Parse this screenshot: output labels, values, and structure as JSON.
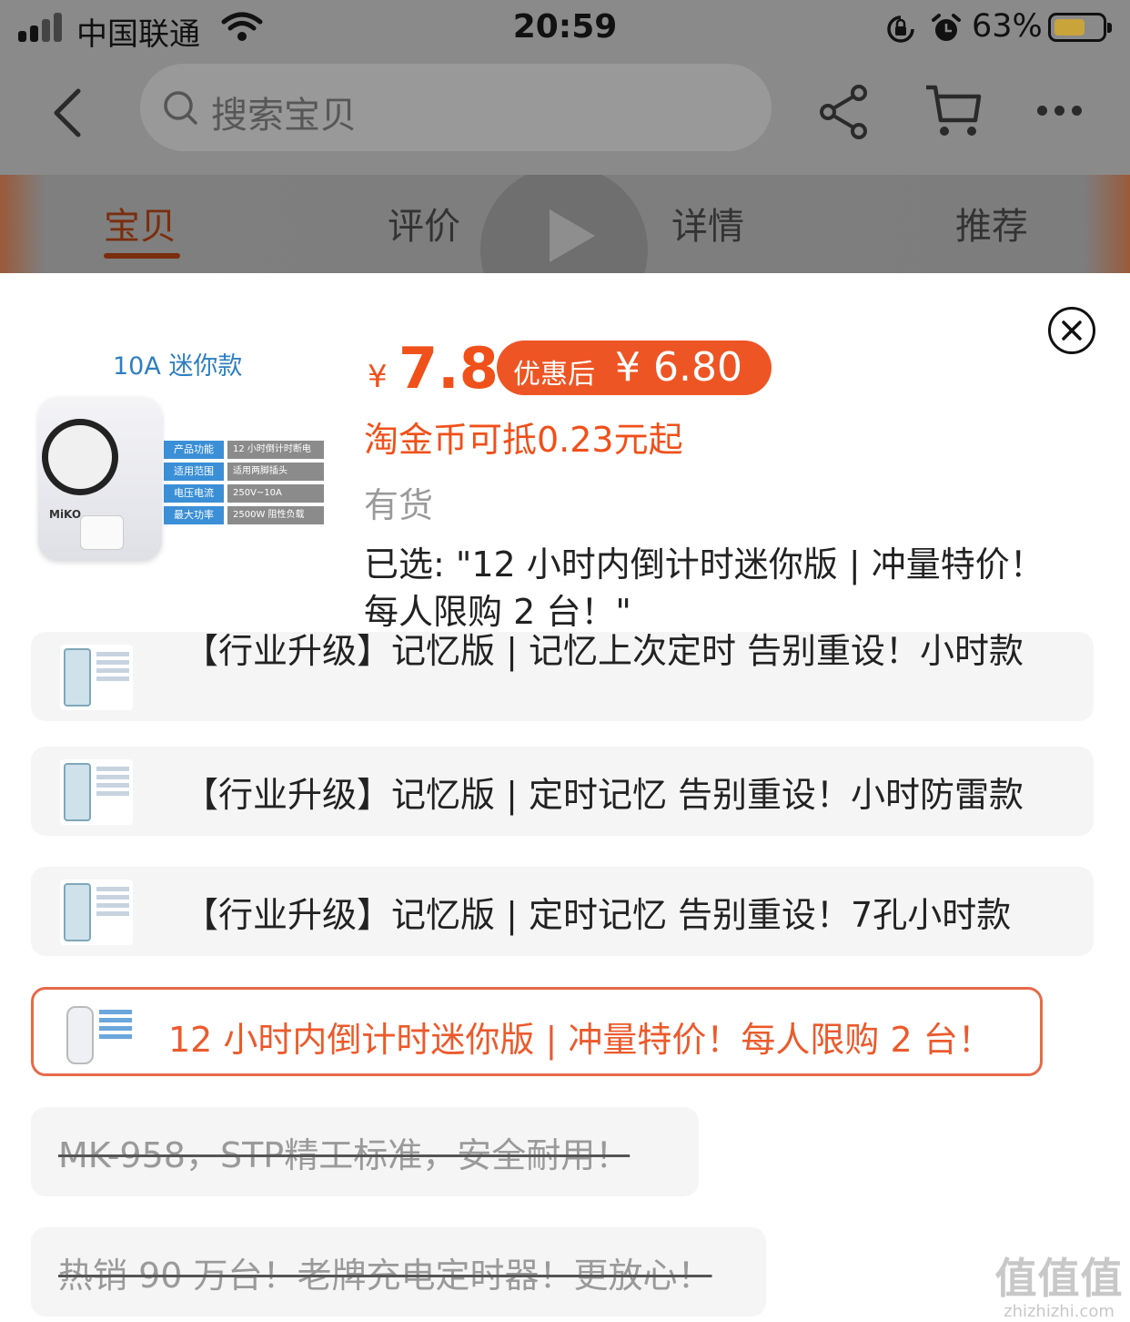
{
  "status_bar": {
    "carrier": "中国联通",
    "time": "20:59",
    "battery_percent": "63%",
    "battery_level": 0.63,
    "icons": [
      "signal-icon",
      "wifi-icon",
      "orientation-lock-icon",
      "alarm-icon",
      "battery-icon"
    ]
  },
  "nav": {
    "search_placeholder": "搜索宝贝",
    "icons": [
      "back-icon",
      "search-icon",
      "share-icon",
      "cart-icon",
      "more-icon"
    ]
  },
  "tabs": [
    {
      "label": "宝贝",
      "active": true
    },
    {
      "label": "评价",
      "active": false
    },
    {
      "label": "详情",
      "active": false
    },
    {
      "label": "推荐",
      "active": false
    }
  ],
  "product": {
    "thumb_title": "10A 迷你款",
    "thumb_brand": "MiKO",
    "thumb_specs": [
      {
        "k": "产品功能",
        "v": "12 小时倒计时断电"
      },
      {
        "k": "适用范围",
        "v": "适用两脚插头"
      },
      {
        "k": "电压电流",
        "v": "250V~10A"
      },
      {
        "k": "最大功率",
        "v": "2500W 阻性负载"
      }
    ],
    "currency": "¥",
    "price": "7.8",
    "coupon_label": "优惠后",
    "coupon_price": "¥ 6.80",
    "coin_text": "淘金币可抵0.23元起",
    "stock": "有货",
    "selected": "已选: \"12 小时内倒计时迷你版 | 冲量特价！每人限购 2 台！\""
  },
  "options": [
    {
      "label": "【行业升级】记忆版 | 记忆上次定时 告别重设！小时款",
      "state": "normal"
    },
    {
      "label": "【行业升级】记忆版 | 定时记忆 告别重设！小时防雷款",
      "state": "normal"
    },
    {
      "label": "【行业升级】记忆版 | 定时记忆 告别重设！7孔小时款",
      "state": "normal"
    },
    {
      "label": "12 小时内倒计时迷你版 | 冲量特价！每人限购 2 台！",
      "state": "selected"
    },
    {
      "label": "MK-958，STP精工标准，安全耐用！",
      "state": "disabled"
    },
    {
      "label": "热销 90 万台！老牌充电定时器！更放心！",
      "state": "disabled"
    }
  ],
  "watermark": {
    "text": "值值值",
    "url": "zhizhizhi.com"
  },
  "colors": {
    "accent": "#f0501a",
    "coupon_bg": "#ee5524",
    "thumb_blue": "#2f7fc0",
    "selected_border": "#e86a4a"
  }
}
